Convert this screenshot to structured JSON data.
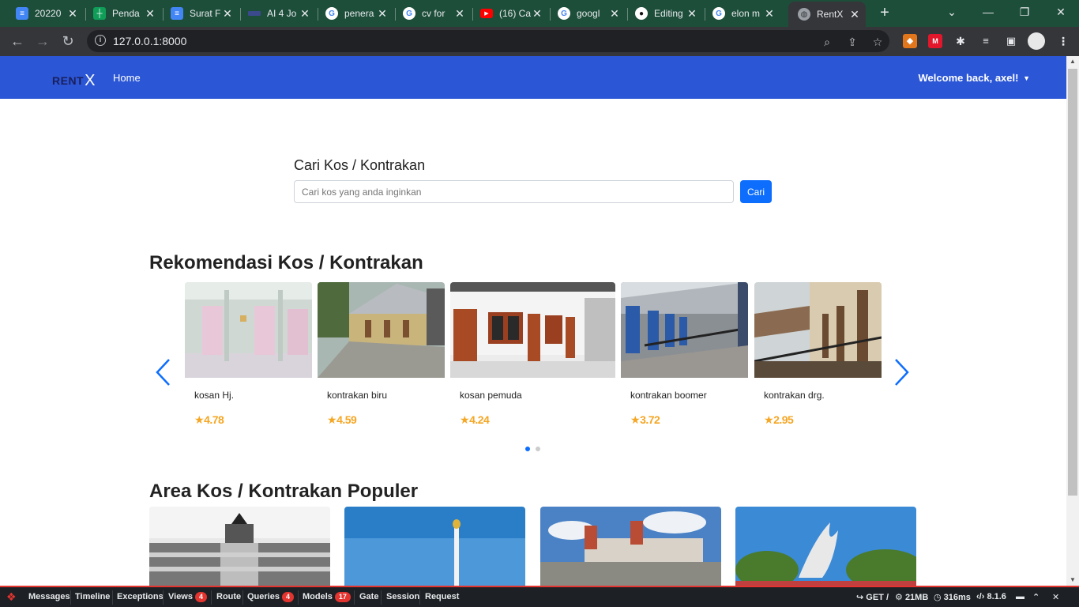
{
  "browser": {
    "tabs": [
      {
        "title": "20220",
        "icon": "google-docs-icon",
        "color": "#4285f4"
      },
      {
        "title": "Penda",
        "icon": "google-sheets-icon",
        "color": "#0f9d58"
      },
      {
        "title": "Surat F",
        "icon": "google-docs-icon",
        "color": "#4285f4"
      },
      {
        "title": "AI 4 Jo",
        "icon": "site-icon",
        "color": "#3a4a8a"
      },
      {
        "title": "penera",
        "icon": "google-icon",
        "color": "#ffffff"
      },
      {
        "title": "cv for",
        "icon": "google-icon",
        "color": "#ffffff"
      },
      {
        "title": "(16) Ca",
        "icon": "youtube-icon",
        "color": "#ff0000"
      },
      {
        "title": "googl",
        "icon": "google-icon",
        "color": "#ffffff"
      },
      {
        "title": "Editing",
        "icon": "github-icon",
        "color": "#ffffff"
      },
      {
        "title": "elon m",
        "icon": "google-icon",
        "color": "#ffffff"
      },
      {
        "title": "RentX",
        "icon": "globe-icon",
        "color": "#9aa0a6"
      }
    ],
    "url": "127.0.0.1:8000"
  },
  "navbar": {
    "brand_text": "RENT",
    "brand_mark": "X",
    "home": "Home",
    "user": "Welcome back, axel!"
  },
  "search": {
    "title": "Cari Kos / Kontrakan",
    "placeholder": "Cari kos yang anda inginkan",
    "button": "Cari"
  },
  "recommend": {
    "title": "Rekomendasi Kos / Kontrakan",
    "items": [
      {
        "name": "kosan Hj.",
        "rating": "4.78"
      },
      {
        "name": "kontrakan biru",
        "rating": "4.59"
      },
      {
        "name": "kosan pemuda",
        "rating": "4.24"
      },
      {
        "name": "kontrakan boomer",
        "rating": "3.72"
      },
      {
        "name": "kontrakan drg.",
        "rating": "2.95"
      }
    ],
    "active_slide": 1,
    "slide_count": 2
  },
  "areas": {
    "title": "Area Kos / Kontrakan Populer"
  },
  "debugbar": {
    "items": [
      "Messages",
      "Timeline",
      "Exceptions",
      "Views",
      "Route",
      "Queries",
      "Models",
      "Gate",
      "Session",
      "Request"
    ],
    "views_count": "4",
    "queries_count": "4",
    "models_count": "17",
    "method": "GET /",
    "memory": "21MB",
    "time": "316ms",
    "version": "8.1.6"
  },
  "colors": {
    "navbar": "#2b56d6",
    "primary": "#0d6efd",
    "rating": "#f5a623",
    "debug_accent": "#e3342f"
  }
}
